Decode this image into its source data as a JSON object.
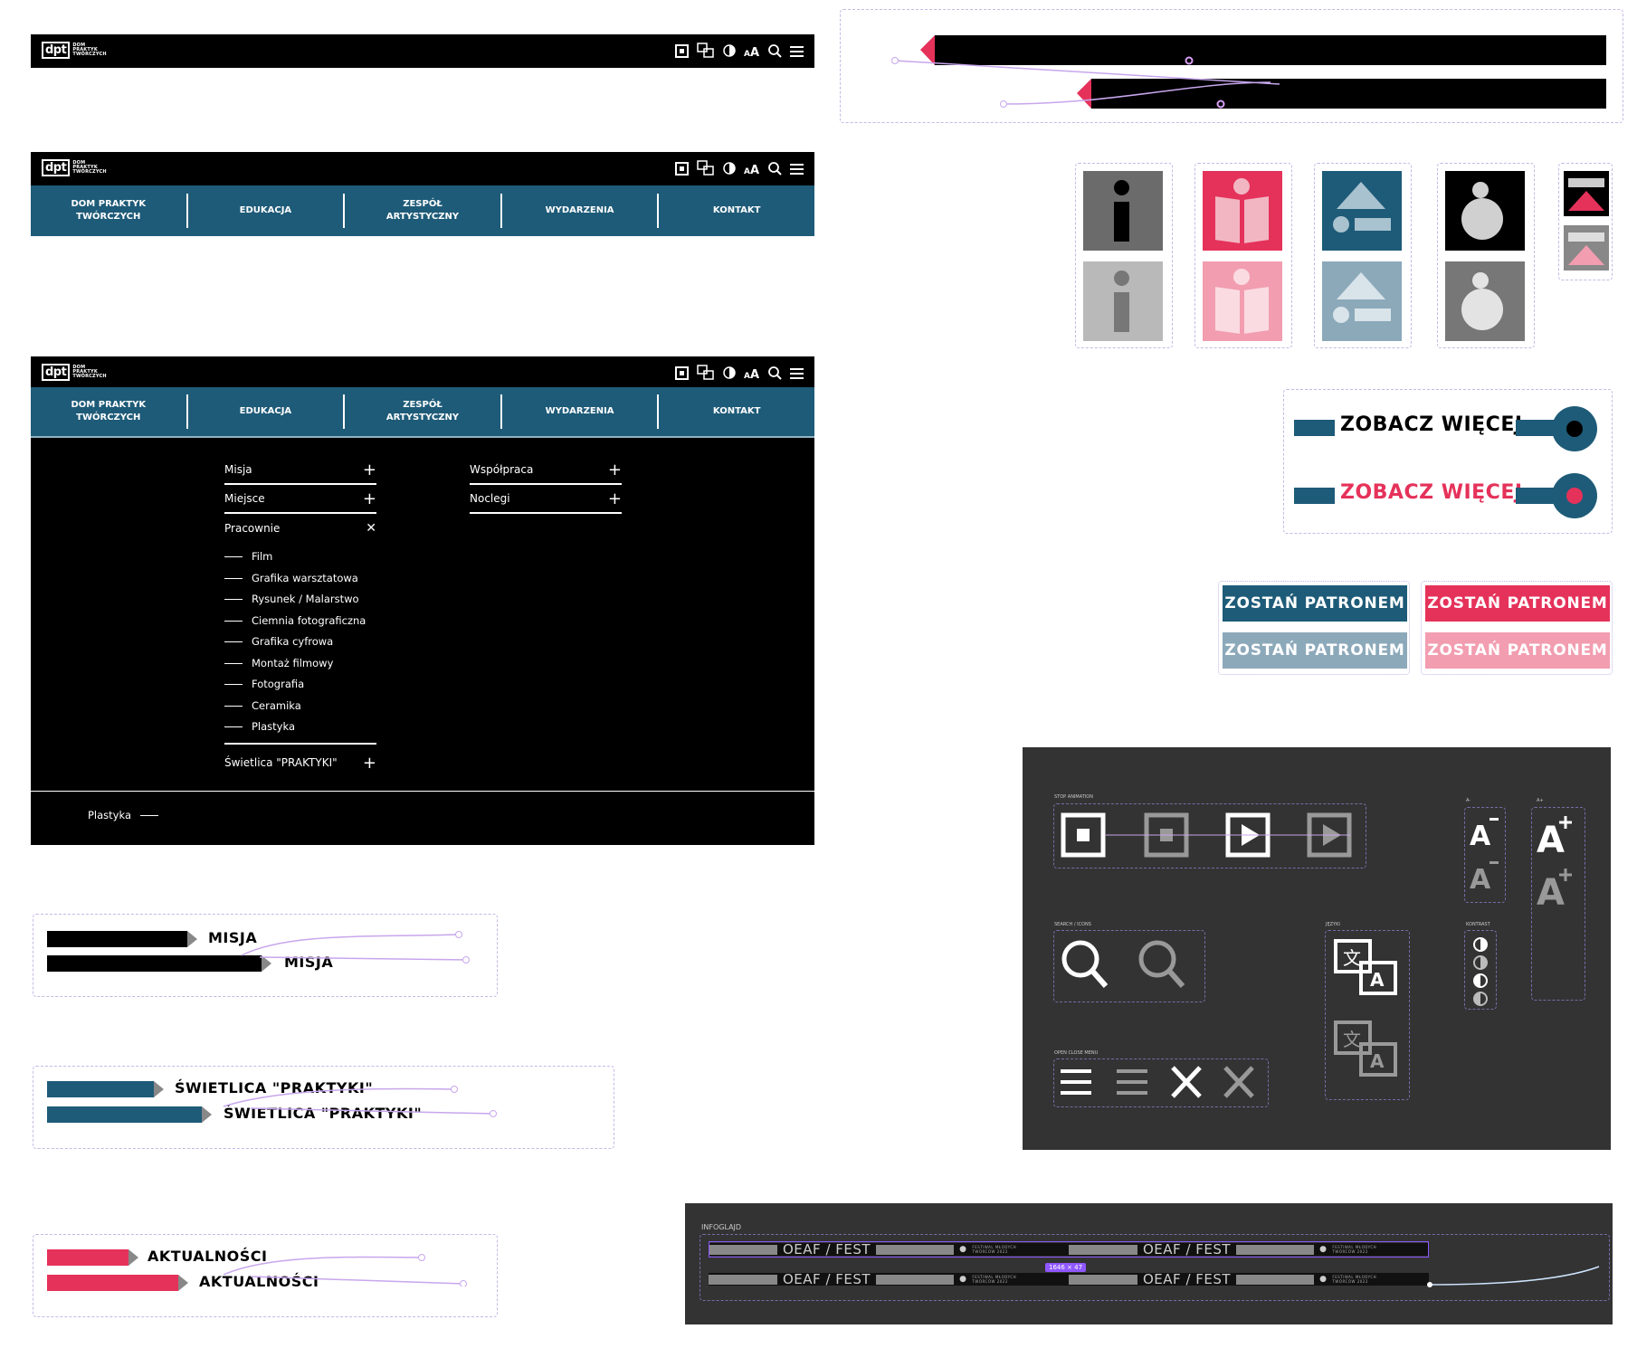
{
  "logo": {
    "mark": "dpt",
    "line1": "DOM",
    "line2": "PRAKTYK",
    "line3": "TWÓRCZYCH"
  },
  "nav": [
    {
      "line1": "DOM PRAKTYK",
      "line2": "TWÓRCZYCH"
    },
    {
      "line1": "EDUKACJA",
      "line2": ""
    },
    {
      "line1": "ZESPÓŁ",
      "line2": "ARTYSTYCZNY"
    },
    {
      "line1": "WYDARZENIA",
      "line2": ""
    },
    {
      "line1": "KONTAKT",
      "line2": ""
    }
  ],
  "menu": {
    "col1": [
      "Misja",
      "Miejsce",
      "Pracownie"
    ],
    "col2": [
      "Współpraca",
      "Noclegi"
    ],
    "subitems": [
      "Film",
      "Grafika warsztatowa",
      "Rysunek / Malarstwo",
      "Ciemnia fotograficzna",
      "Grafika cyfrowa",
      "Montaż filmowy",
      "Fotografia",
      "Ceramika",
      "Plastyka"
    ],
    "last": "Świetlica \"PRAKTYKI\"",
    "footer": "Plastyka"
  },
  "tags": {
    "misja": "MISJA",
    "swietlica": "ŚWIETLICA \"PRAKTYKI\"",
    "aktualnosci": "AKTUALNOŚCI"
  },
  "cta": {
    "zobacz": "ZOBACZ WIĘCEJ",
    "patron": "ZOSTAŃ PATRONEM"
  },
  "icons_panel": {
    "stop": "STOP ANIMATION",
    "search": "SEARCH / ICONS",
    "lang": "JĘZYKI",
    "contrast": "KONTRAST",
    "font_minus": "A-",
    "font_plus": "A+",
    "menu": "OPEN CLOSE MENU"
  },
  "infobar": {
    "label": "INFOGLAJD",
    "text": "OEAF / FEST",
    "fest1": "FESTIWAL MŁODYCH",
    "fest2": "TWÓRCÓW 2022",
    "size": "1646 × 47"
  },
  "colors": {
    "teal": "#1e5b78",
    "pink": "#e5325a",
    "nav": "#1e5b78"
  }
}
